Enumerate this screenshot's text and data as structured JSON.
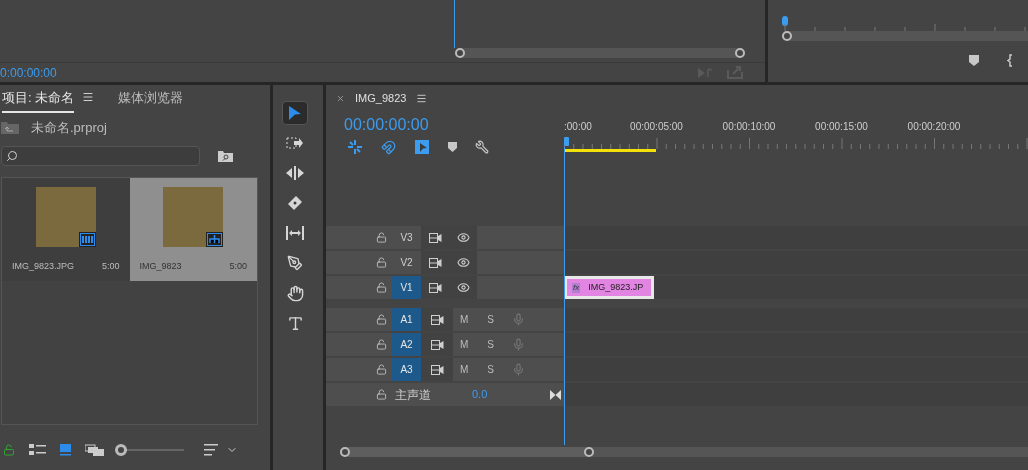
{
  "program_monitor": {
    "timecode": "0:00:00:00"
  },
  "project_panel": {
    "tabs": [
      {
        "label": "项目: 未命名",
        "selected": true
      },
      {
        "label": "媒体浏览器",
        "selected": false
      }
    ],
    "project_file": "未命名.prproj",
    "items": [
      {
        "name": "IMG_9823.JPG",
        "duration": "5:00",
        "kind": "still",
        "selected": false
      },
      {
        "name": "IMG_9823",
        "duration": "5:00",
        "kind": "sequence",
        "selected": true
      }
    ],
    "zoom": {
      "level": 0.05
    }
  },
  "tools": [
    {
      "kind": "selection",
      "selected": true
    },
    {
      "kind": "track-select",
      "selected": false
    },
    {
      "kind": "ripple",
      "selected": false
    },
    {
      "kind": "razor",
      "selected": false
    },
    {
      "kind": "slip",
      "selected": false
    },
    {
      "kind": "pen",
      "selected": false
    },
    {
      "kind": "hand",
      "selected": false
    },
    {
      "kind": "type",
      "selected": false
    }
  ],
  "timeline": {
    "tab": "IMG_9823",
    "timecode": "00:00:00:00",
    "toggles": [
      {
        "kind": "nest",
        "on": true
      },
      {
        "kind": "snap",
        "on": true
      },
      {
        "kind": "linked",
        "on": true
      }
    ],
    "ruler": [
      ":00:00",
      "00:00:05:00",
      "00:00:10:00",
      "00:00:15:00",
      "00:00:20:00"
    ],
    "tracks": [
      {
        "kind": "video",
        "name": "V3",
        "target": false
      },
      {
        "kind": "video",
        "name": "V2",
        "target": false
      },
      {
        "kind": "video",
        "name": "V1",
        "target": true,
        "clip": {
          "badge": "fx",
          "label": "IMG_9823.JP"
        }
      },
      {
        "kind": "audio",
        "name": "A1",
        "target": true,
        "mute": "M",
        "solo": "S"
      },
      {
        "kind": "audio",
        "name": "A2",
        "target": true,
        "mute": "M",
        "solo": "S"
      },
      {
        "kind": "audio",
        "name": "A3",
        "target": true,
        "mute": "M",
        "solo": "S"
      }
    ],
    "master": {
      "label": "主声道",
      "value": "0.0"
    }
  }
}
